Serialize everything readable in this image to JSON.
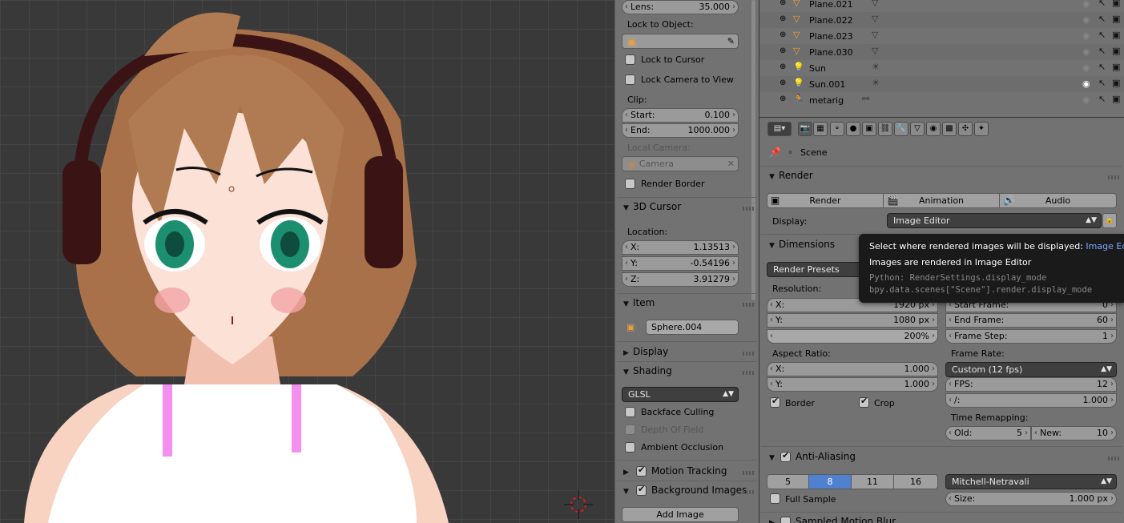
{
  "colors": {
    "panel": "#727272",
    "viewport": "#393939",
    "active_tab": "#5080d0",
    "tooltip_bg": "#1a1a1a",
    "tooltip_link": "#7fa7ff"
  },
  "view": {
    "lens": {
      "key": "Lens:",
      "val": "35.000"
    },
    "lock_to_object": "Lock to Object:",
    "lock_to_cursor": "Lock to Cursor",
    "lock_camera": "Lock Camera to View",
    "clip": "Clip:",
    "clip_start": {
      "key": "Start:",
      "val": "0.100"
    },
    "clip_end": {
      "key": "End:",
      "val": "1000.000"
    },
    "local_camera": "Local Camera:",
    "camera_field": "Camera",
    "render_border": "Render Border"
  },
  "cursor3d": {
    "title": "3D Cursor",
    "location": "Location:",
    "x": {
      "key": "X:",
      "val": "1.13513"
    },
    "y": {
      "key": "Y:",
      "val": "-0.54196"
    },
    "z": {
      "key": "Z:",
      "val": "3.91279"
    }
  },
  "item": {
    "title": "Item",
    "name": "Sphere.004"
  },
  "display_title": "Display",
  "shading": {
    "title": "Shading",
    "mode": "GLSL",
    "backface": "Backface Culling",
    "dof": "Depth Of Field",
    "ao": "Ambient Occlusion"
  },
  "motion_tracking": "Motion Tracking",
  "background_images": "Background Images",
  "add_image": "Add Image",
  "outliner": {
    "rows": [
      {
        "name": "Plane.021",
        "icon": "mesh"
      },
      {
        "name": "Plane.022",
        "icon": "mesh"
      },
      {
        "name": "Plane.023",
        "icon": "mesh"
      },
      {
        "name": "Plane.030",
        "icon": "mesh"
      },
      {
        "name": "Sun",
        "icon": "lamp"
      },
      {
        "name": "Sun.001",
        "icon": "lamp"
      },
      {
        "name": "metarig",
        "icon": "armature"
      }
    ]
  },
  "props": {
    "scene": "Scene",
    "render_panel": "Render",
    "render_btn": "Render",
    "animation_btn": "Animation",
    "audio_btn": "Audio",
    "display_label": "Display:",
    "display_value": "Image Editor",
    "dimensions": "Dimensions",
    "render_presets": "Render Presets",
    "resolution": "Resolution:",
    "res_x": {
      "key": "X:",
      "val": "1920 px"
    },
    "res_y": {
      "key": "Y:",
      "val": "1080 px"
    },
    "res_pct": "200%",
    "start_frame": {
      "key": "Start Frame:",
      "val": "0"
    },
    "end_frame": {
      "key": "End Frame:",
      "val": "60"
    },
    "frame_step": {
      "key": "Frame Step:",
      "val": "1"
    },
    "aspect": "Aspect Ratio:",
    "asp_x": {
      "key": "X:",
      "val": "1.000"
    },
    "asp_y": {
      "key": "Y:",
      "val": "1.000"
    },
    "frame_rate": "Frame Rate:",
    "frame_rate_val": "Custom (12 fps)",
    "fps": {
      "key": "FPS:",
      "val": "12"
    },
    "fps_base": {
      "key": "/:",
      "val": "1.000"
    },
    "border": "Border",
    "crop": "Crop",
    "time_remap": "Time Remapping:",
    "old": {
      "key": "Old:",
      "val": "5"
    },
    "new": {
      "key": "New:",
      "val": "10"
    },
    "antialiasing": "Anti-Aliasing",
    "aa_samples": [
      "5",
      "8",
      "11",
      "16"
    ],
    "aa_filter": "Mitchell-Netravali",
    "full_sample": "Full Sample",
    "size": {
      "key": "Size:",
      "val": "1.000 px"
    },
    "sampled_motion_blur": "Sampled Motion Blur"
  },
  "tooltip": {
    "title": "Select where rendered images will be displayed:",
    "title_value": "Image Editor",
    "desc": "Images are rendered in Image Editor",
    "py1": "Python: RenderSettings.display_mode",
    "py2": "bpy.data.scenes[\"Scene\"].render.display_mode"
  }
}
